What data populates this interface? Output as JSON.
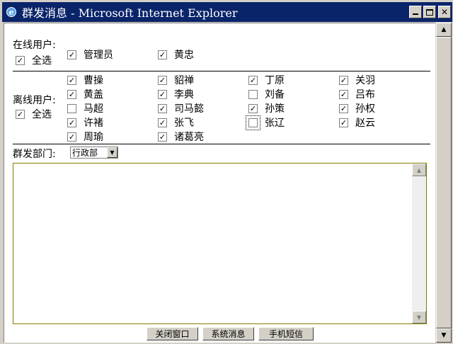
{
  "window": {
    "title": "群发消息 - Microsoft Internet Explorer",
    "minimize": "_",
    "maximize": "□",
    "close": "✕"
  },
  "online": {
    "label": "在线用户:",
    "select_all": "全选",
    "users": [
      {
        "name": "管理员",
        "checked": true
      },
      {
        "name": "黄忠",
        "checked": true
      }
    ]
  },
  "offline": {
    "label": "离线用户:",
    "select_all": "全选",
    "users": [
      {
        "name": "曹操",
        "checked": true
      },
      {
        "name": "貂禅",
        "checked": true
      },
      {
        "name": "丁原",
        "checked": true
      },
      {
        "name": "关羽",
        "checked": true
      },
      {
        "name": "黄盖",
        "checked": true
      },
      {
        "name": "李典",
        "checked": true
      },
      {
        "name": "刘备",
        "checked": false
      },
      {
        "name": "吕布",
        "checked": true
      },
      {
        "name": "马超",
        "checked": false
      },
      {
        "name": "司马懿",
        "checked": true
      },
      {
        "name": "孙策",
        "checked": true
      },
      {
        "name": "孙权",
        "checked": true
      },
      {
        "name": "许褚",
        "checked": true
      },
      {
        "name": "张飞",
        "checked": true
      },
      {
        "name": "张辽",
        "checked": false
      },
      {
        "name": "赵云",
        "checked": true
      },
      {
        "name": "周瑜",
        "checked": true
      },
      {
        "name": "诸葛亮",
        "checked": true
      }
    ]
  },
  "department": {
    "label": "群发部门:",
    "selected": "行政部"
  },
  "message": {
    "value": ""
  },
  "buttons": {
    "close_window": "关闭窗口",
    "system_message": "系统消息",
    "mobile_sms": "手机短信"
  }
}
